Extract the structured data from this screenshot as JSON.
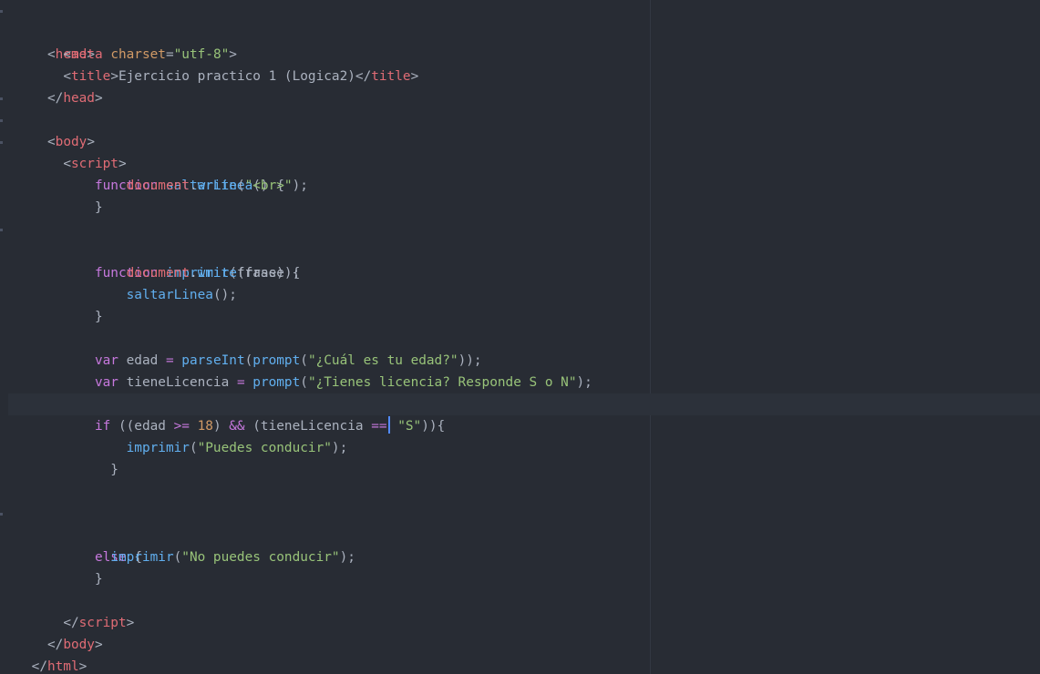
{
  "editor": {
    "lines": {
      "l01": [
        "  ",
        "<",
        "head",
        ">"
      ],
      "l02": [
        "    ",
        "<",
        "meta",
        " ",
        "charset",
        "=",
        "\"utf-8\"",
        ">"
      ],
      "l03": [
        "    ",
        "<",
        "title",
        ">",
        "Ejercicio practico 1 (Logica2)",
        "</",
        "title",
        ">"
      ],
      "l04": [
        "  ",
        "</",
        "head",
        ">"
      ],
      "l05": [
        "  ",
        "<",
        "body",
        ">"
      ],
      "l06": [
        "    ",
        "<",
        "script",
        ">"
      ],
      "l07": [
        "        ",
        "function",
        " ",
        "saltarLinea",
        "() {"
      ],
      "l08": [
        "            ",
        "document",
        ".",
        "write",
        "(",
        "\"<br>\"",
        ");"
      ],
      "l09": [
        "        ",
        "}"
      ],
      "l11": [
        "        ",
        "function",
        " ",
        "imprimir",
        "(frase) {"
      ],
      "l12": [
        "            ",
        "document",
        ".",
        "write",
        "(frase);"
      ],
      "l13": [
        "            ",
        "saltarLinea",
        "();"
      ],
      "l14": [
        "        ",
        "}"
      ],
      "l16": [
        "        ",
        "var",
        " edad ",
        "=",
        " ",
        "parseInt",
        "(",
        "prompt",
        "(",
        "\"¿Cuál es tu edad?\"",
        "));"
      ],
      "l17": [
        "        ",
        "var",
        " tieneLicencia ",
        "=",
        " ",
        "prompt",
        "(",
        "\"¿Tienes licencia? Responde S o N\"",
        ");"
      ],
      "l19": [
        "        ",
        "if",
        " ((edad ",
        ">=",
        " ",
        "18",
        ") ",
        "&&",
        " (tieneLicencia ",
        "==",
        " ",
        "\"S\"",
        ")){"
      ],
      "l20": [
        "            ",
        "imprimir",
        "(",
        "\"Puedes conducir\"",
        ");"
      ],
      "l21": [
        "          ",
        "}"
      ],
      "l24": [
        "        ",
        "else",
        " {"
      ],
      "l25": [
        "          ",
        "imprimir",
        "(",
        "\"No puedes conducir\"",
        ");"
      ],
      "l26": [
        "        ",
        "}"
      ],
      "l28": [
        "    ",
        "</",
        "script",
        ">"
      ],
      "l29": [
        "  ",
        "</",
        "body",
        ">"
      ],
      "l30": [
        "</",
        "html",
        ">"
      ]
    }
  },
  "colors": {
    "background": "#282c34",
    "cursor_line": "#2c313a",
    "tag": "#e06c75",
    "attribute": "#d19a66",
    "string": "#98c379",
    "keyword": "#c678dd",
    "function": "#61afef",
    "number": "#d19a66",
    "caret": "#528bff"
  }
}
